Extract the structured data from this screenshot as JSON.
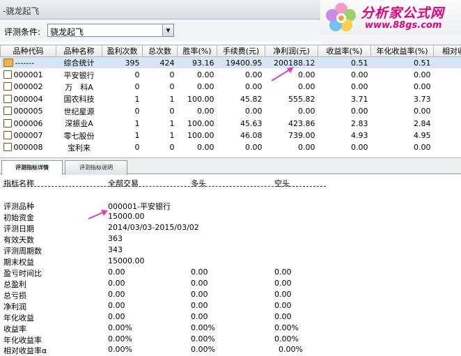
{
  "window": {
    "title": "-骁龙起飞"
  },
  "logo": {
    "brand": "分析家公式网",
    "url": "www.88gs.com"
  },
  "condition": {
    "label": "评测条件:",
    "selected": "骁龙起飞"
  },
  "table": {
    "columns": [
      "品种代码",
      "品种名称",
      "盈利次数",
      "总次数",
      "胜率(%)",
      "手续费(元)",
      "净利润(元)",
      "收益率(%)",
      "年化收益率(%)",
      "相对收"
    ],
    "rows": [
      {
        "icon": "summary-icon",
        "code": "-------",
        "name": "综合统计",
        "win": "395",
        "total": "424",
        "rate": "93.16",
        "fee": "19400.95",
        "profit": "200188.12",
        "yield": "0.51",
        "annual": "0.51"
      },
      {
        "icon": "stock-icon",
        "code": "000001",
        "name": "平安银行",
        "win": "0",
        "total": "0",
        "rate": "0.00",
        "fee": "0.00",
        "profit": "0.00",
        "yield": "0.00",
        "annual": "0.00"
      },
      {
        "icon": "stock-icon",
        "code": "000002",
        "name": "万　科A",
        "win": "0",
        "total": "0",
        "rate": "0.00",
        "fee": "0.00",
        "profit": "0.00",
        "yield": "0.00",
        "annual": "0.00"
      },
      {
        "icon": "stock-icon",
        "code": "000004",
        "name": "国农科技",
        "win": "1",
        "total": "1",
        "rate": "100.00",
        "fee": "45.82",
        "profit": "555.82",
        "yield": "3.71",
        "annual": "3.73"
      },
      {
        "icon": "stock-icon",
        "code": "000005",
        "name": "世纪星源",
        "win": "0",
        "total": "0",
        "rate": "0.00",
        "fee": "0.00",
        "profit": "0.00",
        "yield": "0.00",
        "annual": "0.00"
      },
      {
        "icon": "stock-icon",
        "code": "000006",
        "name": "深振业A",
        "win": "1",
        "total": "1",
        "rate": "100.00",
        "fee": "45.63",
        "profit": "423.86",
        "yield": "2.83",
        "annual": "2.84"
      },
      {
        "icon": "stock-icon",
        "code": "000007",
        "name": "零七股份",
        "win": "1",
        "total": "1",
        "rate": "100.00",
        "fee": "46.08",
        "profit": "739.00",
        "yield": "4.93",
        "annual": "4.95"
      },
      {
        "icon": "stock-icon",
        "code": "000008",
        "name": "宝利来",
        "win": "0",
        "total": "0",
        "rate": "0.00",
        "fee": "0.00",
        "profit": "0.00",
        "yield": "0.00",
        "annual": "0.00"
      }
    ]
  },
  "tabs": {
    "detail": "评测指标详情",
    "desc": "评测指标说明"
  },
  "detail": {
    "headers": {
      "name": "指标名称",
      "all": "全部交易",
      "long": "多头",
      "short": "空头"
    },
    "info": [
      {
        "label": "评测品种",
        "value": "000001-平安银行"
      },
      {
        "label": "初始资金",
        "value": "15000.00"
      },
      {
        "label": "评测日期",
        "value": "2014/03/03-2015/03/02"
      },
      {
        "label": "有效天数",
        "value": "363"
      },
      {
        "label": "评测周期数",
        "value": "343"
      },
      {
        "label": "期末权益",
        "value": "15000.00"
      }
    ],
    "metrics": [
      {
        "label": "盈亏时间比",
        "all": "0.00",
        "long": "0.00",
        "short": "0.00"
      },
      {
        "label": "总盈利",
        "all": "0.00",
        "long": "0.00",
        "short": "0.00"
      },
      {
        "label": "总亏损",
        "all": "0.00",
        "long": "0.00",
        "short": "0.00"
      },
      {
        "label": "净利润",
        "all": "0.00",
        "long": "0.00",
        "short": "0.00"
      },
      {
        "label": "年化收益",
        "all": "0.00",
        "long": "0.00",
        "short": "0.00"
      },
      {
        "label": "收益率",
        "all": "0.00%",
        "long": "0.00%",
        "short": "0.00%"
      },
      {
        "label": "年化收益率",
        "all": "0.00%",
        "long": "0.00%",
        "short": "0.00%"
      },
      {
        "label": "相对收益率α",
        "all": "0.00%",
        "long": "0.00%",
        "short": "0.00%"
      }
    ]
  },
  "colors": {
    "accent": "#e40078",
    "selection": "#d7e6f6"
  }
}
